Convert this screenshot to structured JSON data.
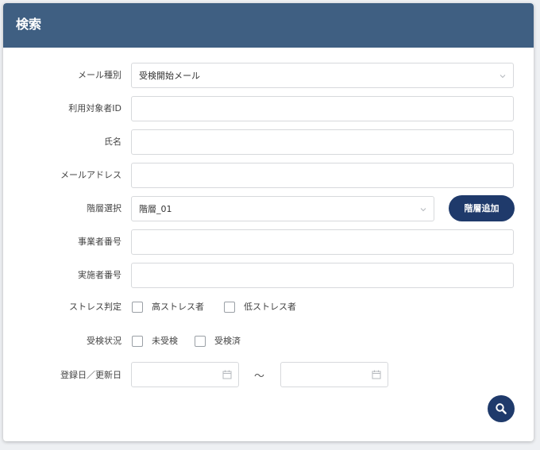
{
  "panel": {
    "title": "検索"
  },
  "fields": {
    "mail_type": {
      "label": "メール種別",
      "value": "受検開始メール"
    },
    "user_id": {
      "label": "利用対象者ID",
      "value": ""
    },
    "name": {
      "label": "氏名",
      "value": ""
    },
    "email": {
      "label": "メールアドレス",
      "value": ""
    },
    "hierarchy": {
      "label": "階層選択",
      "value": "階層_01",
      "add_button": "階層追加"
    },
    "business_no": {
      "label": "事業者番号",
      "value": ""
    },
    "implementer_no": {
      "label": "実施者番号",
      "value": ""
    }
  },
  "stress": {
    "label": "ストレス判定",
    "options": [
      {
        "label": "高ストレス者",
        "checked": false
      },
      {
        "label": "低ストレス者",
        "checked": false
      }
    ]
  },
  "exam_status": {
    "label": "受検状況",
    "options": [
      {
        "label": "未受検",
        "checked": false
      },
      {
        "label": "受検済",
        "checked": false
      }
    ]
  },
  "dates": {
    "label": "登録日／更新日",
    "separator": "～",
    "from": "",
    "to": ""
  },
  "icons": {
    "select": "chevron-down-icon",
    "date": "calendar-icon",
    "search": "search-icon"
  },
  "colors": {
    "header": "#3f5f82",
    "button": "#1f3a6b"
  }
}
